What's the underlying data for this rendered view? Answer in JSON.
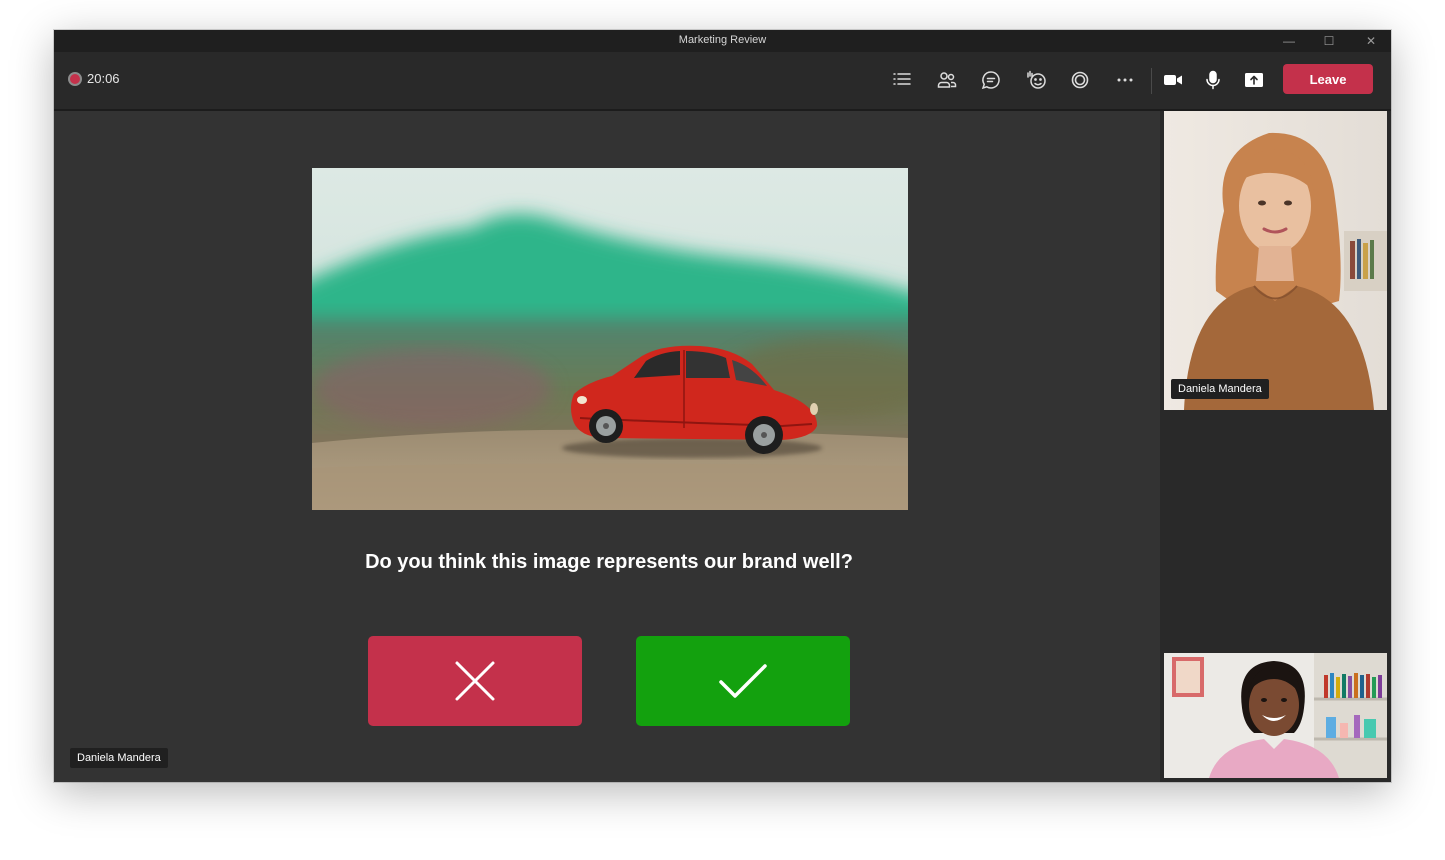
{
  "window": {
    "title": "Marketing Review"
  },
  "window_controls": {
    "minimize": "—",
    "maximize": "☐",
    "close": "✕"
  },
  "toolbar": {
    "timer": "20:06",
    "buttons": [
      {
        "icon": "list-icon"
      },
      {
        "icon": "people-icon"
      },
      {
        "icon": "chat-icon"
      },
      {
        "icon": "reactions-icon"
      },
      {
        "icon": "rooms-icon"
      },
      {
        "icon": "more-icon"
      },
      {
        "icon": "camera-icon"
      },
      {
        "icon": "mic-icon"
      },
      {
        "icon": "share-icon"
      }
    ],
    "leave_label": "Leave"
  },
  "stage": {
    "question": "Do you think this image represents our brand well?",
    "presenter_name": "Daniela Mandera",
    "vote_no_icon": "close-icon",
    "vote_yes_icon": "checkmark-icon"
  },
  "participants": [
    {
      "name": "Daniela Mandera"
    },
    {
      "name": ""
    }
  ],
  "colors": {
    "accent_red": "#c4314b",
    "accent_green": "#13a10e",
    "stage_bg": "#333333",
    "toolbar_bg": "#292929"
  }
}
